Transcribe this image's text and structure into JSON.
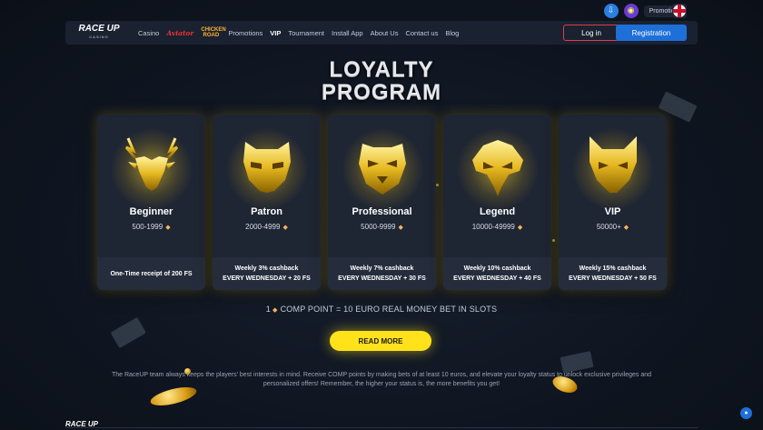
{
  "topbar": {
    "promotions_label": "Promotions",
    "download_icon": "download-icon",
    "gift_icon": "gift-icon",
    "language_flag": "uk-flag-icon"
  },
  "nav": {
    "logo_main": "RACE UP",
    "logo_sub": "CASINO",
    "items": [
      {
        "label": "Casino"
      },
      {
        "label": "Aviator"
      },
      {
        "label": "CHICKEN ROAD"
      },
      {
        "label": "Promotions"
      },
      {
        "label": "VIP"
      },
      {
        "label": "Tournament"
      },
      {
        "label": "Install App"
      },
      {
        "label": "About Us"
      },
      {
        "label": "Contact us"
      },
      {
        "label": "Blog"
      }
    ],
    "login_label": "Log in",
    "register_label": "Registration"
  },
  "hero": {
    "title_line1": "LOYALTY",
    "title_line2": "PROGRAM"
  },
  "levels": [
    {
      "name": "Beginner",
      "range": "500-1999",
      "reward_line1": "One-Time receipt of 200 FS",
      "reward_line2": "",
      "icon": "deer-mask-icon"
    },
    {
      "name": "Patron",
      "range": "2000-4999",
      "reward_line1": "Weekly 3% cashback",
      "reward_line2": "EVERY WEDNESDAY + 20 FS",
      "icon": "raccoon-mask-icon"
    },
    {
      "name": "Professional",
      "range": "5000-9999",
      "reward_line1": "Weekly 7% cashback",
      "reward_line2": "EVERY WEDNESDAY + 30 FS",
      "icon": "tiger-mask-icon"
    },
    {
      "name": "Legend",
      "range": "10000-49999",
      "reward_line1": "Weekly 10% cashback",
      "reward_line2": "EVERY WEDNESDAY + 40 FS",
      "icon": "eagle-mask-icon"
    },
    {
      "name": "VIP",
      "range": "50000+",
      "reward_line1": "Weekly 15% cashback",
      "reward_line2": "EVERY WEDNESDAY + 50 FS",
      "icon": "wolf-mask-icon"
    }
  ],
  "comp_note": {
    "prefix": "1",
    "text": "COMP POINT = 10 EURO REAL MONEY BET IN SLOTS"
  },
  "read_more_label": "READ MORE",
  "description": "The RaceUP team always keeps the players' best interests in mind. Receive COMP points by making bets of at least 10 euros, and elevate your loyalty status to unlock exclusive privileges and personalized offers! Remember, the higher your status is, the more benefits you get!",
  "footer_logo": "RACE UP",
  "colors": {
    "accent_blue": "#1e6fd8",
    "accent_red": "#e23b4c",
    "gold": "#ffe21a",
    "card_bg": "#1e2533"
  }
}
